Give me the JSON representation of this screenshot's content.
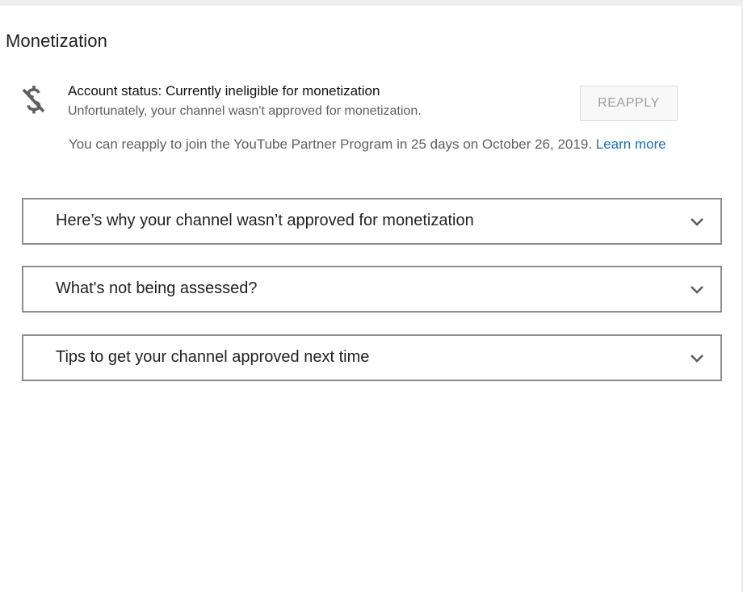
{
  "section": {
    "title": "Monetization"
  },
  "account_status": {
    "icon": "money-off-icon",
    "title": "Account status: Currently ineligible for monetization",
    "subtitle": "Unfortunately, your channel wasn't approved for monetization.",
    "reapply_button": "REAPPLY",
    "reapply_note": "You can reapply to join the YouTube Partner Program in 25 days on October 26, 2019.",
    "learn_more": "Learn more"
  },
  "accordions": [
    {
      "label": "Here’s why your channel wasn’t approved for monetization",
      "icon": "chevron-down-icon"
    },
    {
      "label": "What's not being assessed?",
      "icon": "chevron-down-icon"
    },
    {
      "label": "Tips to get your channel approved next time",
      "icon": "chevron-down-icon"
    }
  ],
  "colors": {
    "link": "#1a6fb5",
    "border": "#8d8d8d",
    "button_bg": "#f8f8f8",
    "button_text": "#9e9e9e"
  }
}
